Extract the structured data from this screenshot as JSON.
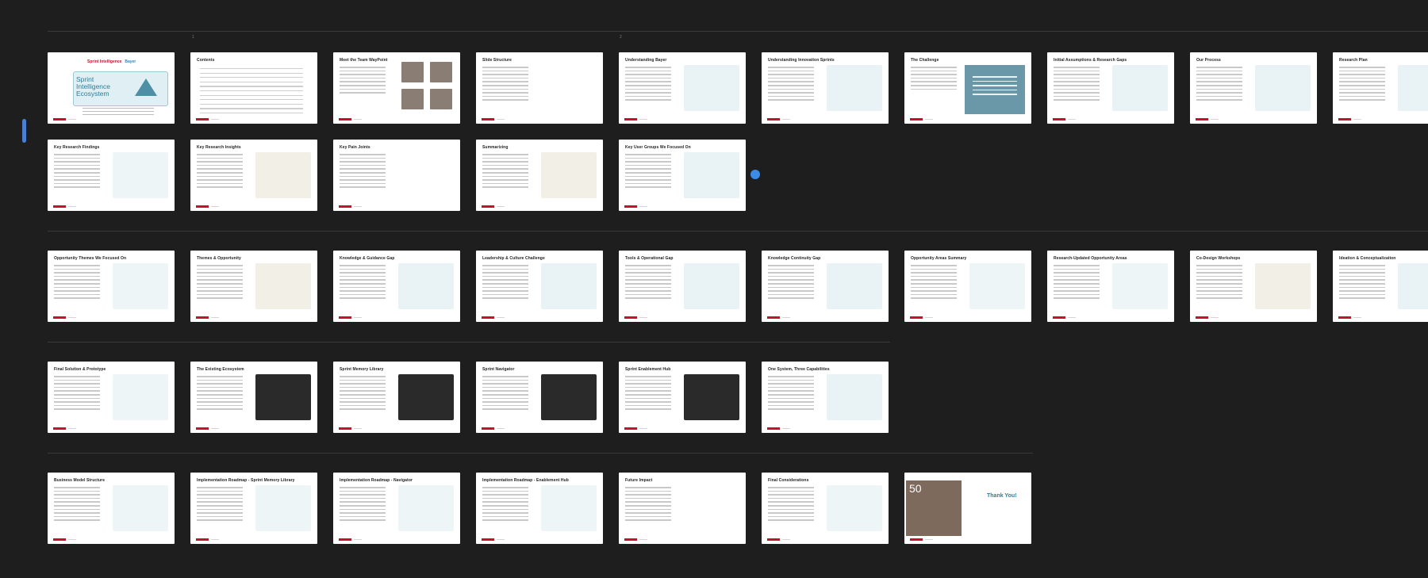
{
  "ruler": {
    "mark_left": "1",
    "mark_right": "2"
  },
  "sections": [
    {
      "slides": [
        {
          "title": "",
          "type": "cover",
          "logo_left": "Sprint Intelligence",
          "logo_right": "Bayer",
          "headline": "Sprint Intelligence Ecosystem"
        },
        {
          "title": "Contents",
          "type": "contents"
        },
        {
          "title": "Meet the Team WayPoint",
          "type": "team"
        },
        {
          "title": "Slide Structure",
          "type": "text"
        },
        {
          "title": "Understanding Bayer",
          "type": "visual"
        },
        {
          "title": "Understanding Innovation Sprints",
          "type": "visual"
        },
        {
          "title": "The Challenge",
          "type": "challenge"
        },
        {
          "title": "Initial Assumptions & Research Gaps",
          "type": "visual"
        },
        {
          "title": "Our Process",
          "type": "visual"
        },
        {
          "title": "Research Plan",
          "type": "visual"
        },
        {
          "title": "Key Research Findings",
          "type": "grid"
        },
        {
          "title": "Key Research Insights",
          "type": "sticky"
        },
        {
          "title": "Key Pain Joints",
          "type": "text"
        },
        {
          "title": "Summarizing",
          "type": "sticky"
        },
        {
          "title": "Key User Groups We Focused On",
          "type": "visual"
        }
      ]
    },
    {
      "slides": [
        {
          "title": "Opportunity Themes We Focused On",
          "type": "grid"
        },
        {
          "title": "Themes & Opportunity",
          "type": "sticky"
        },
        {
          "title": "Knowledge & Guidance Gap",
          "type": "visual"
        },
        {
          "title": "Leadership & Culture Challenge",
          "type": "visual"
        },
        {
          "title": "Tools & Operational Gap",
          "type": "visual"
        },
        {
          "title": "Knowledge Continuity Gap",
          "type": "visual"
        },
        {
          "title": "Opportunity Areas Summary",
          "type": "grid"
        },
        {
          "title": "Research-Updated Opportunity Areas",
          "type": "grid"
        },
        {
          "title": "Co-Design Workshops",
          "type": "sticky"
        },
        {
          "title": "Ideation & Conceptualization",
          "type": "visual"
        }
      ]
    },
    {
      "slides": [
        {
          "title": "Final Solution & Prototype",
          "type": "grid"
        },
        {
          "title": "The Existing Ecosystem",
          "type": "dark"
        },
        {
          "title": "Sprint Memory Library",
          "type": "dark"
        },
        {
          "title": "Sprint Navigator",
          "type": "dark"
        },
        {
          "title": "Sprint Enablement Hub",
          "type": "dark"
        },
        {
          "title": "One System, Three Capabilities",
          "type": "visual"
        }
      ]
    },
    {
      "slides": [
        {
          "title": "Business Model Structure",
          "type": "grid"
        },
        {
          "title": "Implementation Roadmap - Sprint Memory Library",
          "type": "grid"
        },
        {
          "title": "Implementation Roadmap - Navigator",
          "type": "grid"
        },
        {
          "title": "Implementation Roadmap - Enablement Hub",
          "type": "grid"
        },
        {
          "title": "Future Impact",
          "type": "text"
        },
        {
          "title": "Final Considerations",
          "type": "grid"
        },
        {
          "title": "Thank You!",
          "type": "thanks",
          "badge": "50"
        }
      ]
    }
  ],
  "colors": {
    "background": "#1e1e1e",
    "brand_red": "#c8102e",
    "teal": "#2c7e9a",
    "accent_blue": "#3a8ae6"
  }
}
